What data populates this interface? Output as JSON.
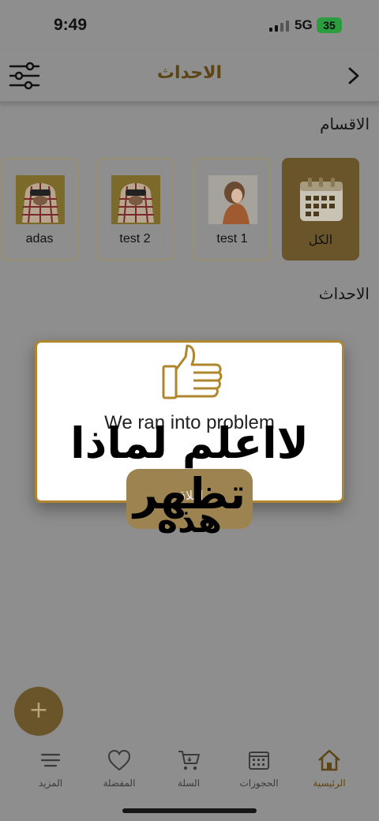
{
  "status_bar": {
    "time": "9:49",
    "network": "5G",
    "battery": "35"
  },
  "header": {
    "title": "الاحداث"
  },
  "sections": {
    "categories": "الاقسام",
    "events": "الاحداث"
  },
  "categories": [
    {
      "label": "الكل",
      "icon": "calendar-icon",
      "active": true
    },
    {
      "label": "test 1",
      "icon": "person-photo",
      "active": false
    },
    {
      "label": "test 2",
      "icon": "person-photo",
      "active": false
    },
    {
      "label": "adas",
      "icon": "person-photo",
      "active": false
    }
  ],
  "dialog": {
    "message": "We ran into problem",
    "close_label": "إغلاق",
    "icon": "thumbs-up-icon"
  },
  "annotation": {
    "line1": "لااعلم لماذا تظهر",
    "line2": "هذه"
  },
  "fab": {
    "label": "+"
  },
  "nav": [
    {
      "label": "المزيد",
      "icon": "menu-icon"
    },
    {
      "label": "المفضلة",
      "icon": "heart-icon"
    },
    {
      "label": "السلة",
      "icon": "cart-icon"
    },
    {
      "label": "الحجوزات",
      "icon": "calendar-icon"
    },
    {
      "label": "الرئيسية",
      "icon": "home-icon",
      "active": true
    }
  ],
  "colors": {
    "accent": "#b0862d",
    "brand_dark": "#6a552a",
    "overlay": "#8e8e8e"
  }
}
